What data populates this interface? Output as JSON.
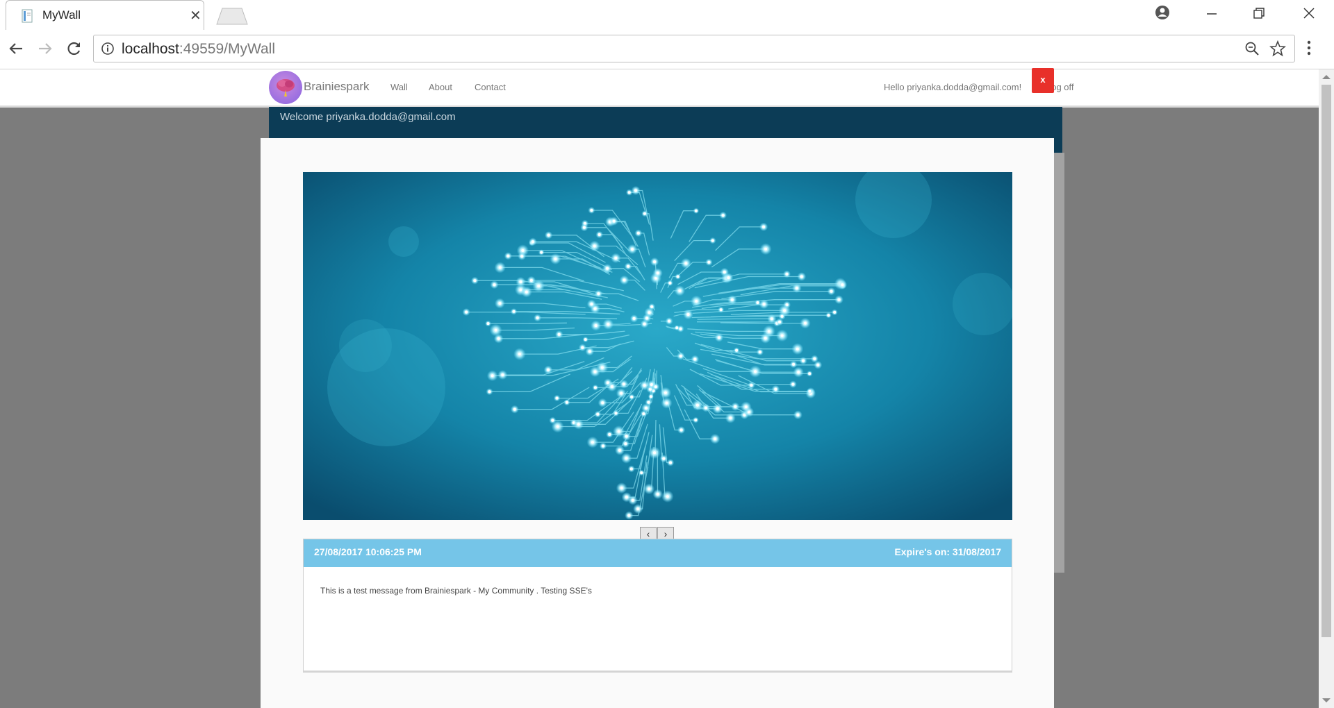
{
  "browser": {
    "tab_title": "MyWall",
    "url_host": "localhost",
    "url_rest": ":49559/MyWall"
  },
  "site": {
    "brand": "Brainiespark",
    "nav": [
      "Wall",
      "About",
      "Contact"
    ],
    "hello": "Hello priyanka.dodda@gmail.com!",
    "logoff": "Log off",
    "welcome": "Welcome priyanka.dodda@gmail.com"
  },
  "modal": {
    "close_label": "x",
    "prev_label": "‹",
    "next_label": "›",
    "post": {
      "date": "27/08/2017 10:06:25 PM",
      "expire": "Expire's on: 31/08/2017",
      "message": "This is a test message from Brainiespark - My Community . Testing SSE's"
    }
  },
  "colors": {
    "welcome_band": "#0c3c56",
    "post_header": "#75c5e8",
    "close_button": "#e8302a"
  },
  "icons": [
    "page-icon",
    "close-icon",
    "back-arrow-icon",
    "forward-arrow-icon",
    "reload-icon",
    "info-icon",
    "zoom-icon",
    "star-icon",
    "account-icon",
    "minimize-icon",
    "restore-icon",
    "menu-dots-icon",
    "brain-circuit-image"
  ]
}
